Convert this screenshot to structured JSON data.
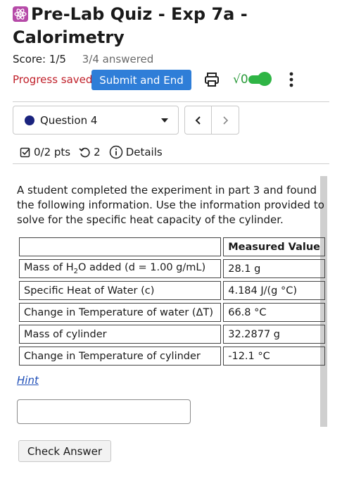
{
  "header": {
    "title": "Pre-Lab Quiz - Exp 7a - Calorimetry",
    "score": "Score: 1/5",
    "answered": "3/4 answered",
    "progress_saved": "Progress saved",
    "submit_label": "Submit and End",
    "math_toggle_label": "√0"
  },
  "question_nav": {
    "selected_question": "Question 4",
    "prev_label": "‹",
    "next_label": "›"
  },
  "meta": {
    "points": "0/2 pts",
    "attempts": "2",
    "details": "Details"
  },
  "question": {
    "text": "A student completed the experiment in part 3 and found the following information. Use the information provided to solve for the specific heat capacity of the cylinder.",
    "table": {
      "header_col1": "",
      "header_col2": "Measured Value",
      "rows": [
        {
          "label_pre": "Mass of H",
          "label_sub": "2",
          "label_post": "O added (d = 1.00 g/mL)",
          "value": "28.1 g"
        },
        {
          "label": "Specific Heat of Water (c)",
          "value": "4.184 J/(g °C)"
        },
        {
          "label": "Change in Temperature of water (ΔT)",
          "value": "66.8 °C"
        },
        {
          "label": "Mass of cylinder",
          "value": "32.2877 g"
        },
        {
          "label": "Change in Temperature of cylinder",
          "value": "-12.1 °C"
        }
      ]
    },
    "hint_label": "Hint",
    "answer_value": "",
    "check_label": "Check Answer"
  },
  "colors": {
    "submit": "#2f7ed8",
    "saved": "#c0202a",
    "toggle": "#2fb545",
    "question_dot": "#1a237e",
    "hint": "#1f4fb8"
  }
}
